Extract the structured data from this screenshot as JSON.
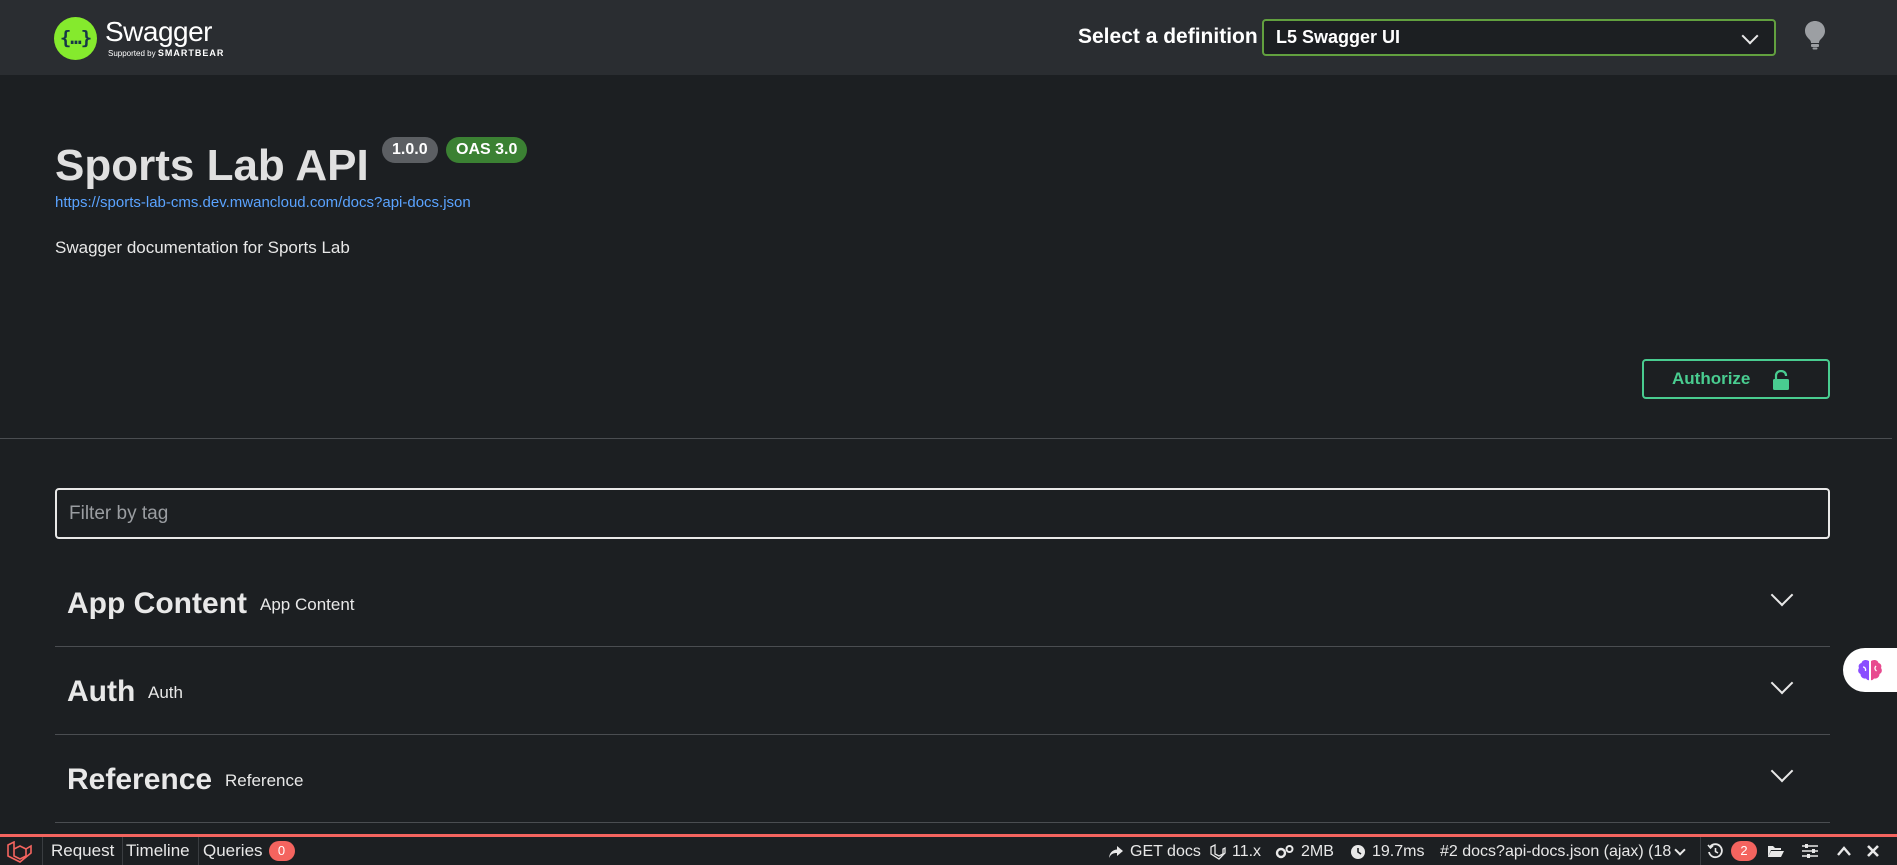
{
  "header": {
    "logo_title": "Swagger",
    "logo_sub_prefix": "Supported by",
    "logo_sub_brand": "SMARTBEAR",
    "definition_label": "Select a definition",
    "definition_value": "L5 Swagger UI"
  },
  "info": {
    "title": "Sports Lab API",
    "version": "1.0.0",
    "oas": "OAS 3.0",
    "url": "https://sports-lab-cms.dev.mwancloud.com/docs?api-docs.json",
    "description": "Swagger documentation for Sports Lab",
    "authorize_label": "Authorize"
  },
  "filter": {
    "placeholder": "Filter by tag"
  },
  "tags": [
    {
      "name": "App Content",
      "description": "App Content"
    },
    {
      "name": "Auth",
      "description": "Auth"
    },
    {
      "name": "Reference",
      "description": "Reference"
    }
  ],
  "debugbar": {
    "request": "Request",
    "timeline": "Timeline",
    "queries": "Queries",
    "queries_count": "0",
    "route": "GET docs",
    "laravel_version": "11.x",
    "memory": "2MB",
    "time": "19.7ms",
    "ajax_request": "#2 docs?api-docs.json (ajax) (18",
    "history_count": "2"
  },
  "colors": {
    "accent_green": "#49cc90",
    "select_border": "#62a03f",
    "logo_green": "#85ea2d",
    "link_blue": "#5aa3ff",
    "debugbar_red": "#f4645f"
  }
}
